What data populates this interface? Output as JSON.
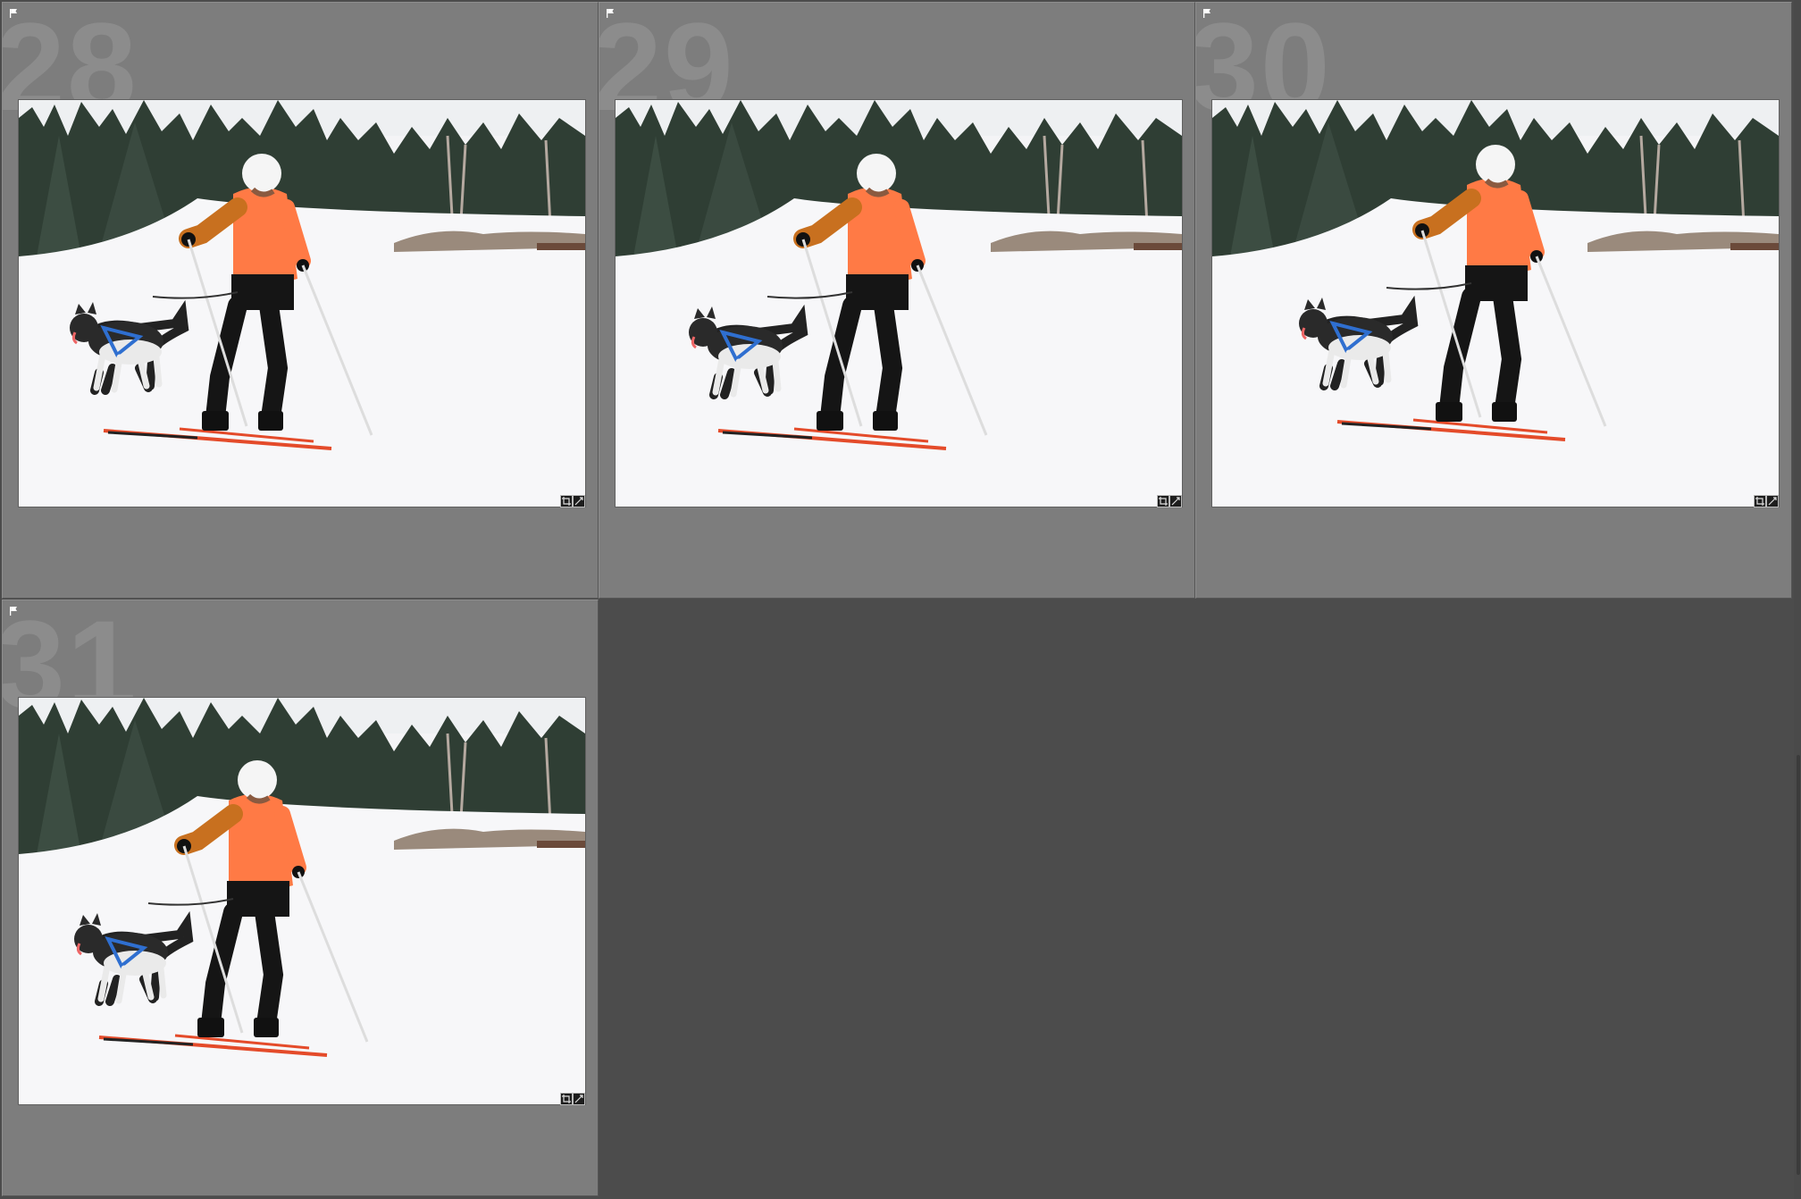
{
  "grid": {
    "cells": [
      {
        "number": "28",
        "flag": "flag-icon",
        "badges": [
          "crop-icon",
          "edit-icon"
        ],
        "image": "skier-with-husky"
      },
      {
        "number": "29",
        "flag": "flag-icon",
        "badges": [
          "crop-icon",
          "edit-icon"
        ],
        "image": "skier-with-husky"
      },
      {
        "number": "30",
        "flag": "flag-icon",
        "badges": [
          "crop-icon",
          "edit-icon"
        ],
        "image": "skier-with-husky"
      },
      {
        "number": "31",
        "flag": "flag-icon",
        "badges": [
          "crop-icon",
          "edit-icon"
        ],
        "image": "skier-with-husky"
      }
    ]
  },
  "colors": {
    "cell_background": "#7d7d7d",
    "empty_background": "#4c4c4c",
    "jacket": "#ff7a45",
    "sleeve": "#c8701f",
    "harness": "#2f6fd0"
  }
}
